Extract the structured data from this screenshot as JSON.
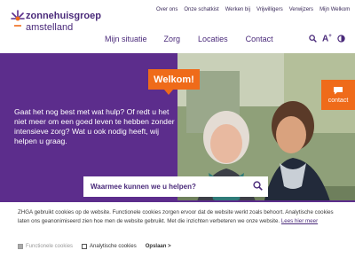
{
  "logo": {
    "line1": "zonnehuisgroep",
    "line2": "amstelland"
  },
  "util_nav": [
    "Over ons",
    "Onze schatkist",
    "Werken bij",
    "Vrijwilligers",
    "Verwijzers",
    "Mijn Welkom"
  ],
  "main_nav": [
    "Mijn situatie",
    "Zorg",
    "Locaties",
    "Contact"
  ],
  "tools": {
    "text_size": "A",
    "text_size_sup": "+"
  },
  "hero": {
    "welcome_badge": "Welkom!",
    "contact_tab": "contact",
    "text": "Gaat het nog best met wat hulp? Of redt u het niet meer om een goed leven te hebben zonder intensieve zorg? Wat u ook nodig heeft, wij helpen u graag."
  },
  "search": {
    "placeholder": "Waarmee kunnen we u helpen?"
  },
  "cookie": {
    "text": "ZHGA gebruikt cookies op de website. Functionele cookies zorgen ervoor dat de website werkt zoals behoort. Analytische cookies laten ons geanonimiseerd zien hoe men de website gebruikt. Met die inzichten verbeteren we onze website.",
    "read_more": "Lees hier meer",
    "functional_label": "Functionele cookies",
    "analytics_label": "Analytische cookies",
    "save_label": "Opslaan >"
  },
  "colors": {
    "brand_purple": "#5c2d8c",
    "accent_orange": "#ef6b1a"
  }
}
